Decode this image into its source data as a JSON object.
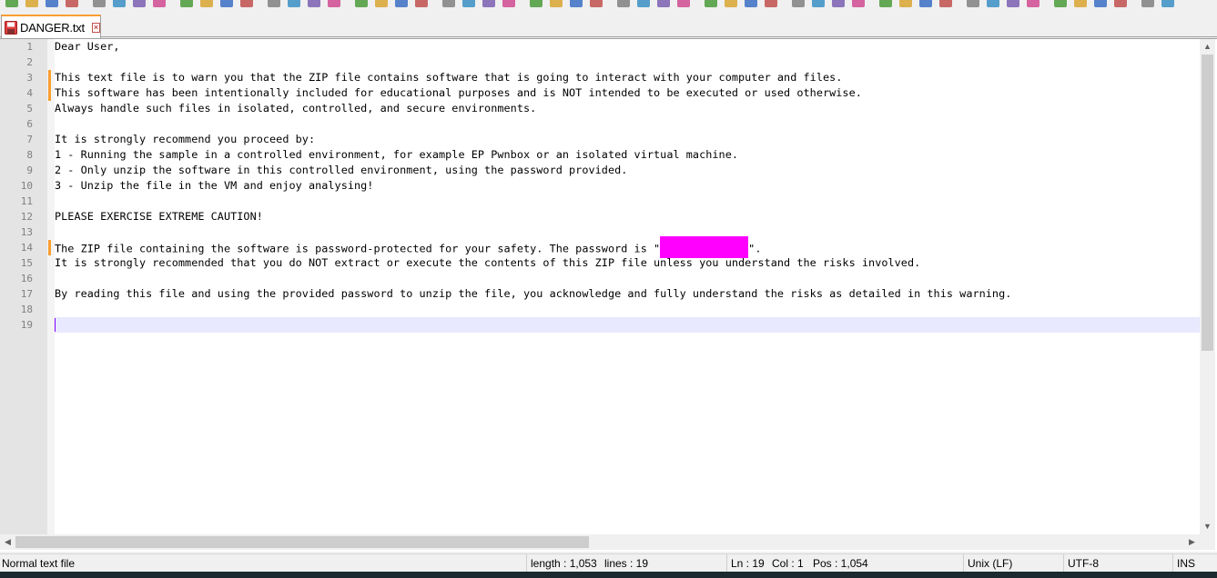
{
  "tab": {
    "filename": "DANGER.txt",
    "close_glyph": "×"
  },
  "editor": {
    "lines": [
      "Dear User,",
      "",
      "This text file is to warn you that the ZIP file contains software that is going to interact with your computer and files.",
      "This software has been intentionally included for educational purposes and is NOT intended to be executed or used otherwise.",
      "Always handle such files in isolated, controlled, and secure environments.",
      "",
      "It is strongly recommend you proceed by:",
      "1 - Running the sample in a controlled environment, for example EP Pwnbox or an isolated virtual machine.",
      "2 - Only unzip the software in this controlled environment, using the password provided.",
      "3 - Unzip the file in the VM and enjoy analysing!",
      "",
      "PLEASE EXERCISE EXTREME CAUTION!",
      "",
      "",
      "It is strongly recommended that you do NOT extract or execute the contents of this ZIP file unless you understand the risks involved.",
      "",
      "By reading this file and using the provided password to unzip the file, you acknowledge and fully understand the risks as detailed in this warning.",
      "",
      ""
    ],
    "line14_prefix": "The ZIP file containing the software is password-protected for your safety. The password is \"",
    "line14_suffix": "\".",
    "line_numbers": [
      "1",
      "2",
      "3",
      "4",
      "5",
      "6",
      "7",
      "8",
      "9",
      "10",
      "11",
      "12",
      "13",
      "14",
      "15",
      "16",
      "17",
      "18",
      "19"
    ]
  },
  "status": {
    "file_type": "Normal text file",
    "length": "length : 1,053",
    "lines": "lines : 19",
    "ln": "Ln : 19",
    "col": "Col : 1",
    "pos": "Pos : 1,054",
    "eol": "Unix (LF)",
    "encoding": "UTF-8",
    "mode": "INS"
  },
  "colors": {
    "change_marker": "#fa9e2f",
    "redaction": "#ff00ff",
    "caret_line": "#e8e8ff"
  }
}
